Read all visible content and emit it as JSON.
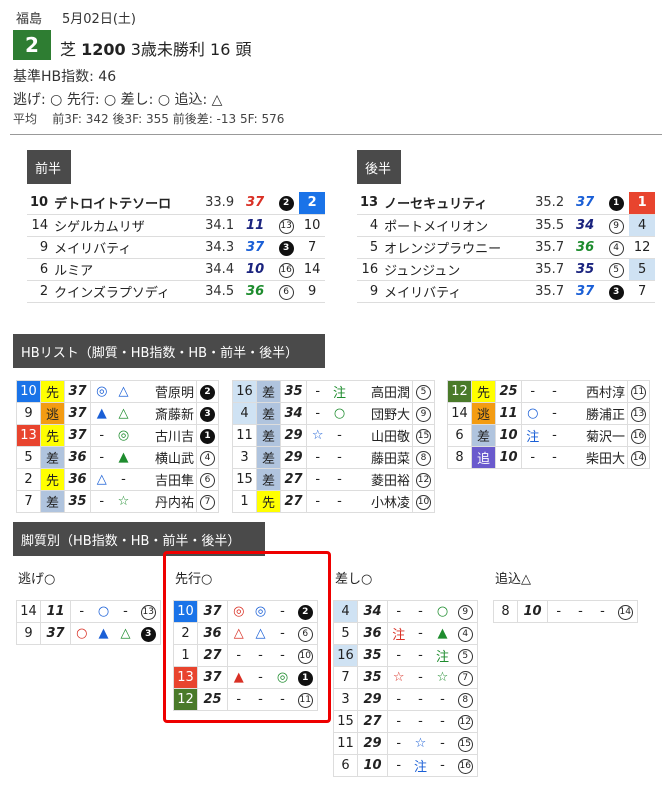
{
  "header": {
    "venue": "福島",
    "date": "5月02日(土)",
    "race_no": "2",
    "surface": "芝",
    "distance": "1200",
    "race_class": "3歳未勝利",
    "heads": "16 頭",
    "base_hb": "基準HB指数: 46",
    "pace_line": "逃げ: ○ 先行: ○ 差し: ○ 追込: △",
    "avg_label": "平均",
    "avg_vals": [
      {
        "k": "前3F:",
        "v": "342"
      },
      {
        "k": "後3F:",
        "v": "355"
      },
      {
        "k": "前後差:",
        "v": "-13"
      },
      {
        "k": "5F:",
        "v": "576"
      }
    ]
  },
  "first_half": {
    "label": "前半",
    "rows": [
      {
        "no": "10",
        "name": "デトロイトテソーロ",
        "time": "33.9",
        "hb": "37",
        "hb_color": "red",
        "rank": "2",
        "rank_style": "filled",
        "pos": "2",
        "pos_color": "blue"
      },
      {
        "no": "14",
        "name": "シゲルカムリザ",
        "time": "34.1",
        "hb": "11",
        "hb_color": "navy",
        "rank": "13",
        "rank_style": "outline",
        "pos": "10",
        "pos_color": ""
      },
      {
        "no": "9",
        "name": "メイリバティ",
        "time": "34.3",
        "hb": "37",
        "hb_color": "blue",
        "rank": "3",
        "rank_style": "filled",
        "pos": "7",
        "pos_color": ""
      },
      {
        "no": "6",
        "name": "ルミア",
        "time": "34.4",
        "hb": "10",
        "hb_color": "navy",
        "rank": "16",
        "rank_style": "outline",
        "pos": "14",
        "pos_color": ""
      },
      {
        "no": "2",
        "name": "クインズラプソディ",
        "time": "34.5",
        "hb": "36",
        "hb_color": "green",
        "rank": "6",
        "rank_style": "outline",
        "pos": "9",
        "pos_color": ""
      }
    ]
  },
  "second_half": {
    "label": "後半",
    "rows": [
      {
        "no": "13",
        "name": "ノーセキュリティ",
        "time": "35.2",
        "hb": "37",
        "hb_color": "blue",
        "rank": "1",
        "rank_style": "filled",
        "pos": "1",
        "pos_color": "red"
      },
      {
        "no": "4",
        "name": "ポートメイリオン",
        "time": "35.5",
        "hb": "34",
        "hb_color": "navy",
        "rank": "9",
        "rank_style": "outline",
        "pos": "4",
        "pos_color": "lblue"
      },
      {
        "no": "5",
        "name": "オレンジプラウニー",
        "time": "35.7",
        "hb": "36",
        "hb_color": "green",
        "rank": "4",
        "rank_style": "outline",
        "pos": "12",
        "pos_color": ""
      },
      {
        "no": "16",
        "name": "ジュンジュン",
        "time": "35.7",
        "hb": "35",
        "hb_color": "navy",
        "rank": "5",
        "rank_style": "outline",
        "pos": "5",
        "pos_color": "lblue"
      },
      {
        "no": "9",
        "name": "メイリバティ",
        "time": "35.7",
        "hb": "37",
        "hb_color": "blue",
        "rank": "3",
        "rank_style": "filled",
        "pos": "7",
        "pos_color": ""
      }
    ]
  },
  "hb_list": {
    "label": "HBリスト（脚質・HB指数・HB・前半・後半）",
    "columns": [
      [
        {
          "no": "10",
          "no_color": "blue",
          "type": "先",
          "type_cls": "senko",
          "hb": "37",
          "m1": "◎",
          "m1c": "blue",
          "m2": "△",
          "m2c": "blue",
          "jockey": "菅原明",
          "rank": "2",
          "rank_style": "filled"
        },
        {
          "no": "9",
          "no_color": "",
          "type": "逃",
          "type_cls": "nige",
          "hb": "37",
          "m1": "▲",
          "m1c": "blue",
          "m2": "△",
          "m2c": "green",
          "jockey": "斎藤新",
          "rank": "3",
          "rank_style": "filled"
        },
        {
          "no": "13",
          "no_color": "red",
          "type": "先",
          "type_cls": "senko",
          "hb": "37",
          "m1": "-",
          "m1c": "",
          "m2": "◎",
          "m2c": "green",
          "jockey": "古川吉",
          "rank": "1",
          "rank_style": "filled"
        },
        {
          "no": "5",
          "no_color": "",
          "type": "差",
          "type_cls": "sashi",
          "hb": "36",
          "m1": "-",
          "m1c": "",
          "m2": "▲",
          "m2c": "green",
          "jockey": "横山武",
          "rank": "4",
          "rank_style": "outline"
        },
        {
          "no": "2",
          "no_color": "",
          "type": "先",
          "type_cls": "senko",
          "hb": "36",
          "m1": "△",
          "m1c": "blue",
          "m2": "-",
          "m2c": "",
          "jockey": "吉田隼",
          "rank": "6",
          "rank_style": "outline"
        },
        {
          "no": "7",
          "no_color": "",
          "type": "差",
          "type_cls": "sashi",
          "hb": "35",
          "m1": "-",
          "m1c": "",
          "m2": "☆",
          "m2c": "green",
          "jockey": "丹内祐",
          "rank": "7",
          "rank_style": "outline"
        }
      ],
      [
        {
          "no": "16",
          "no_color": "lblue",
          "type": "差",
          "type_cls": "sashi",
          "hb": "35",
          "m1": "-",
          "m1c": "",
          "m2": "注",
          "m2c": "green",
          "jockey": "高田潤",
          "rank": "5",
          "rank_style": "outline"
        },
        {
          "no": "4",
          "no_color": "lblue",
          "type": "差",
          "type_cls": "sashi",
          "hb": "34",
          "m1": "-",
          "m1c": "",
          "m2": "○",
          "m2c": "green",
          "jockey": "団野大",
          "rank": "9",
          "rank_style": "outline"
        },
        {
          "no": "11",
          "no_color": "",
          "type": "差",
          "type_cls": "sashi",
          "hb": "29",
          "m1": "☆",
          "m1c": "blue",
          "m2": "-",
          "m2c": "",
          "jockey": "山田敬",
          "rank": "15",
          "rank_style": "outline"
        },
        {
          "no": "3",
          "no_color": "",
          "type": "差",
          "type_cls": "sashi",
          "hb": "29",
          "m1": "-",
          "m1c": "",
          "m2": "-",
          "m2c": "",
          "jockey": "藤田菜",
          "rank": "8",
          "rank_style": "outline"
        },
        {
          "no": "15",
          "no_color": "",
          "type": "差",
          "type_cls": "sashi",
          "hb": "27",
          "m1": "-",
          "m1c": "",
          "m2": "-",
          "m2c": "",
          "jockey": "菱田裕",
          "rank": "12",
          "rank_style": "outline"
        },
        {
          "no": "1",
          "no_color": "",
          "type": "先",
          "type_cls": "senko",
          "hb": "27",
          "m1": "-",
          "m1c": "",
          "m2": "-",
          "m2c": "",
          "jockey": "小林凌",
          "rank": "10",
          "rank_style": "outline"
        }
      ],
      [
        {
          "no": "12",
          "no_color": "green",
          "type": "先",
          "type_cls": "senko",
          "hb": "25",
          "m1": "-",
          "m1c": "",
          "m2": "-",
          "m2c": "",
          "jockey": "西村淳",
          "rank": "11",
          "rank_style": "outline"
        },
        {
          "no": "14",
          "no_color": "",
          "type": "逃",
          "type_cls": "nige",
          "hb": "11",
          "m1": "○",
          "m1c": "blue",
          "m2": "-",
          "m2c": "",
          "jockey": "勝浦正",
          "rank": "13",
          "rank_style": "outline"
        },
        {
          "no": "6",
          "no_color": "",
          "type": "差",
          "type_cls": "sashi",
          "hb": "10",
          "m1": "注",
          "m1c": "blue",
          "m2": "-",
          "m2c": "",
          "jockey": "菊沢一",
          "rank": "16",
          "rank_style": "outline"
        },
        {
          "no": "8",
          "no_color": "",
          "type": "追",
          "type_cls": "oikomi",
          "hb": "10",
          "m1": "-",
          "m1c": "",
          "m2": "-",
          "m2c": "",
          "jockey": "柴田大",
          "rank": "14",
          "rank_style": "outline"
        }
      ]
    ]
  },
  "by_style": {
    "label": "脚質別（HB指数・HB・前半・後半）",
    "groups": [
      {
        "title": "逃げ○",
        "rows": [
          {
            "no": "14",
            "no_color": "",
            "hb": "11",
            "m1": "-",
            "m1c": "",
            "m2": "○",
            "m2c": "blue",
            "m3": "-",
            "m3c": "",
            "rank": "13",
            "rank_style": "outline"
          },
          {
            "no": "9",
            "no_color": "",
            "hb": "37",
            "m1": "○",
            "m1c": "red",
            "m2": "▲",
            "m2c": "blue",
            "m3": "△",
            "m3c": "green",
            "rank": "3",
            "rank_style": "filled"
          }
        ]
      },
      {
        "title": "先行○",
        "rows": [
          {
            "no": "10",
            "no_color": "blue",
            "hb": "37",
            "m1": "◎",
            "m1c": "red",
            "m2": "◎",
            "m2c": "blue",
            "m3": "-",
            "m3c": "",
            "rank": "2",
            "rank_style": "filled"
          },
          {
            "no": "2",
            "no_color": "",
            "hb": "36",
            "m1": "△",
            "m1c": "red",
            "m2": "△",
            "m2c": "blue",
            "m3": "-",
            "m3c": "",
            "rank": "6",
            "rank_style": "outline"
          },
          {
            "no": "1",
            "no_color": "",
            "hb": "27",
            "m1": "-",
            "m1c": "",
            "m2": "-",
            "m2c": "",
            "m3": "-",
            "m3c": "",
            "rank": "10",
            "rank_style": "outline"
          },
          {
            "no": "13",
            "no_color": "red",
            "hb": "37",
            "m1": "▲",
            "m1c": "red",
            "m2": "-",
            "m2c": "",
            "m3": "◎",
            "m3c": "green",
            "rank": "1",
            "rank_style": "filled"
          },
          {
            "no": "12",
            "no_color": "green",
            "hb": "25",
            "m1": "-",
            "m1c": "",
            "m2": "-",
            "m2c": "",
            "m3": "-",
            "m3c": "",
            "rank": "11",
            "rank_style": "outline"
          }
        ]
      },
      {
        "title": "差し○",
        "rows": [
          {
            "no": "4",
            "no_color": "lblue",
            "hb": "34",
            "m1": "-",
            "m1c": "",
            "m2": "-",
            "m2c": "",
            "m3": "○",
            "m3c": "green",
            "rank": "9",
            "rank_style": "outline"
          },
          {
            "no": "5",
            "no_color": "",
            "hb": "36",
            "m1": "注",
            "m1c": "red",
            "m2": "-",
            "m2c": "",
            "m3": "▲",
            "m3c": "green",
            "rank": "4",
            "rank_style": "outline"
          },
          {
            "no": "16",
            "no_color": "lblue",
            "hb": "35",
            "m1": "-",
            "m1c": "",
            "m2": "-",
            "m2c": "",
            "m3": "注",
            "m3c": "green",
            "rank": "5",
            "rank_style": "outline"
          },
          {
            "no": "7",
            "no_color": "",
            "hb": "35",
            "m1": "☆",
            "m1c": "red",
            "m2": "-",
            "m2c": "",
            "m3": "☆",
            "m3c": "green",
            "rank": "7",
            "rank_style": "outline"
          },
          {
            "no": "3",
            "no_color": "",
            "hb": "29",
            "m1": "-",
            "m1c": "",
            "m2": "-",
            "m2c": "",
            "m3": "-",
            "m3c": "",
            "rank": "8",
            "rank_style": "outline"
          },
          {
            "no": "15",
            "no_color": "",
            "hb": "27",
            "m1": "-",
            "m1c": "",
            "m2": "-",
            "m2c": "",
            "m3": "-",
            "m3c": "",
            "rank": "12",
            "rank_style": "outline"
          },
          {
            "no": "11",
            "no_color": "",
            "hb": "29",
            "m1": "-",
            "m1c": "",
            "m2": "☆",
            "m2c": "blue",
            "m3": "-",
            "m3c": "",
            "rank": "15",
            "rank_style": "outline"
          },
          {
            "no": "6",
            "no_color": "",
            "hb": "10",
            "m1": "-",
            "m1c": "",
            "m2": "注",
            "m2c": "blue",
            "m3": "-",
            "m3c": "",
            "rank": "16",
            "rank_style": "outline"
          }
        ]
      },
      {
        "title": "追込△",
        "rows": [
          {
            "no": "8",
            "no_color": "",
            "hb": "10",
            "m1": "-",
            "m1c": "",
            "m2": "-",
            "m2c": "",
            "m3": "-",
            "m3c": "",
            "rank": "14",
            "rank_style": "outline"
          }
        ]
      }
    ]
  },
  "colors": {
    "green_badge": "#2e7d32",
    "red_frame": "#e00000",
    "header_tag": "#4a4a4a"
  }
}
